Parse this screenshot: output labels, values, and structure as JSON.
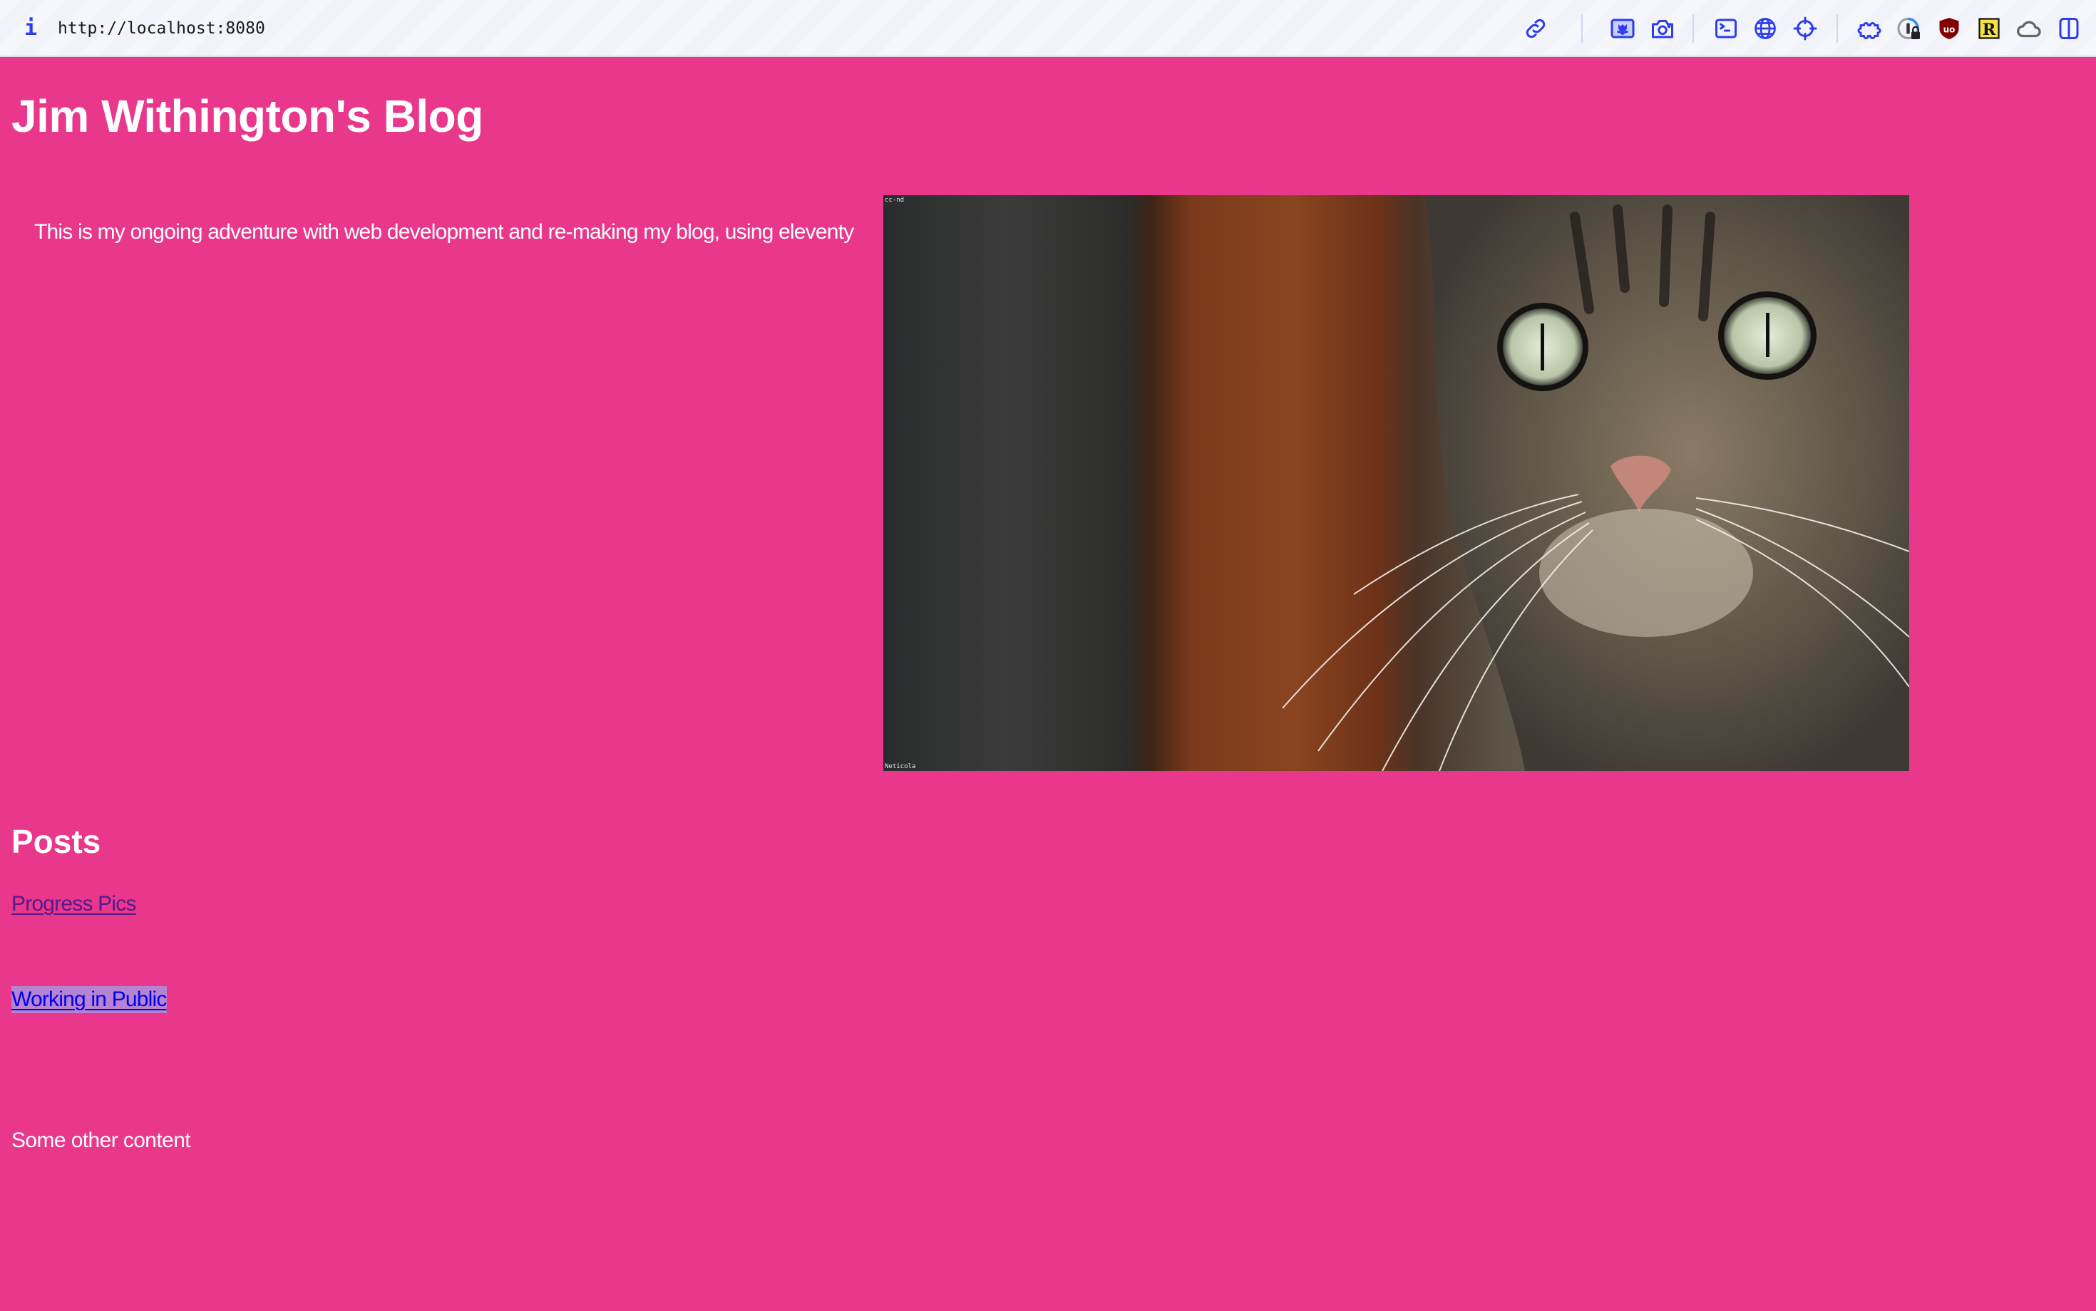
{
  "browser": {
    "url": "http://localhost:8080",
    "toolbar_icons": [
      {
        "name": "copy-link-icon",
        "group": 1
      },
      {
        "name": "picture-in-picture-icon",
        "group": 2
      },
      {
        "name": "screenshot-camera-icon",
        "group": 2
      },
      {
        "name": "terminal-icon",
        "group": 3
      },
      {
        "name": "globe-icon",
        "group": 3
      },
      {
        "name": "crosshair-icon",
        "group": 3
      },
      {
        "name": "extensions-puzzle-icon",
        "group": 4
      },
      {
        "name": "password-manager-icon",
        "group": 4
      },
      {
        "name": "ublock-origin-icon",
        "group": 4
      },
      {
        "name": "readwise-r-icon",
        "group": 4
      },
      {
        "name": "cloud-icon",
        "group": 4
      },
      {
        "name": "sidebar-toggle-icon",
        "group": 4
      }
    ],
    "readwise_letter": "R",
    "ublock_label": "uo"
  },
  "page": {
    "title": "Jim Withington's Blog",
    "intro": "This is my ongoing adventure with web development and re-making my blog, using eleventy",
    "hero_image": {
      "alt": "Close-up of a tabby cat with green eyes",
      "caption_top": "cc-nd",
      "caption_bottom": "Neticola"
    },
    "posts_heading": "Posts",
    "posts": [
      {
        "title": "Progress Pics",
        "state": "visited"
      },
      {
        "title": "Working in Public",
        "state": "selected"
      }
    ],
    "other_content": "Some other content"
  },
  "colors": {
    "page_background": "#e9378c",
    "heading_text": "#ffffff",
    "visited_link": "#551a8b",
    "link": "#0000ee",
    "selection_highlight": "#b583d1",
    "toolbar_icon_accent": "#2b3df0"
  }
}
